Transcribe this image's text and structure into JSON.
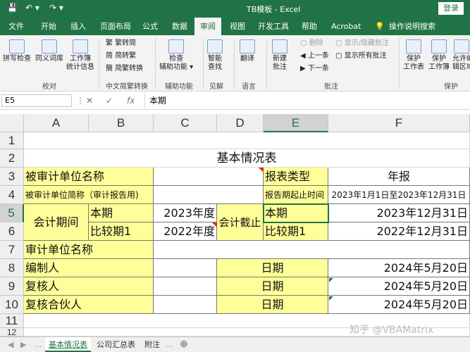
{
  "window": {
    "title": "TB模板  -  Excel",
    "login": "登录"
  },
  "tabs": [
    "文件",
    "开始",
    "插入",
    "页面布局",
    "公式",
    "数据",
    "审阅",
    "视图",
    "开发工具",
    "帮助",
    "Acrobat",
    "操作说明搜索"
  ],
  "active_tab": "审阅",
  "ribbon": {
    "spell": "拼写检查",
    "thesaurus": "同义词库",
    "stats1": "工作簿",
    "stats2": "统计信息",
    "g_proof": "校对",
    "to_trad": "繁转简",
    "to_simp": "简转繁",
    "convert": "简繁转换",
    "g_chinese": "中文简繁转换",
    "check1": "检查",
    "check2": "辅助功能 ▾",
    "g_access": "辅助功能",
    "smart1": "智能",
    "smart2": "查找",
    "g_insight": "见解",
    "translate": "翻译",
    "g_lang": "语言",
    "newc1": "新建",
    "newc2": "批注",
    "delete": "删除",
    "prev": "上一条",
    "next": "下一条",
    "show_c": "显示/隐藏批注",
    "show_all": "显示所有批注",
    "g_comments": "批注",
    "protect_ws1": "保护",
    "protect_ws2": "工作表",
    "protect_wb1": "保护",
    "protect_wb2": "工作簿",
    "allow1": "允许编",
    "allow2": "辑区域",
    "g_protect": "保护"
  },
  "formula_bar": {
    "name": "E5",
    "cancel": "✕",
    "confirm": "✓",
    "fx": "fx",
    "value": "本期"
  },
  "columns": [
    "A",
    "B",
    "C",
    "D",
    "E",
    "F"
  ],
  "rows": [
    "1",
    "2",
    "3",
    "4",
    "5",
    "6",
    "7",
    "8",
    "9",
    "10",
    "11",
    "12"
  ],
  "cells": {
    "title": "基本情况表",
    "a3": "被审计单位名称",
    "e3": "报表类型",
    "f3": "年报",
    "a4": "被审计单位简称（审计报告用)",
    "e4": "报告期起止时间",
    "f4": "2023年1月1日至2023年12月31日",
    "a5": "会计期间",
    "b5": "本期",
    "c5": "2023年度",
    "d5": "会计截止",
    "e5": "本期",
    "f5": "2023年12月31日",
    "b6": "比较期1",
    "c6": "2022年度",
    "e6": "比较期1",
    "f6": "2022年12月31日",
    "a7": "审计单位名称",
    "a8": "编制人",
    "e8": "日期",
    "f8": "2024年5月20日",
    "a9": "复核人",
    "e9": "日期",
    "f9": "2024年5月20日",
    "a10": "复核合伙人",
    "e10": "日期",
    "f10": "2024年5月20日"
  },
  "sheets": [
    "基本情况表",
    "公司汇总表",
    "附注"
  ],
  "watermark": "知乎 @VBAMatrix",
  "colors": {
    "excel_green": "#217346",
    "yellow_fill": "#ffff99"
  }
}
